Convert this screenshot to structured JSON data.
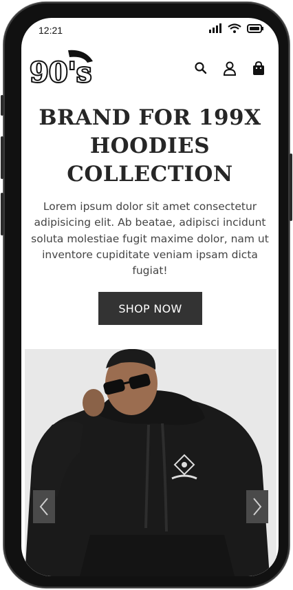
{
  "status_bar": {
    "time": "12:21"
  },
  "header": {
    "logo_text": "90's",
    "icons": [
      "search-icon",
      "user-icon",
      "shopping-bag-icon"
    ]
  },
  "hero": {
    "title_lines": [
      "BRAND FOR 199X",
      "HOODIES",
      "COLLECTION"
    ],
    "description": "Lorem ipsum dolor sit amet consectetur adipisicing elit. Ab beatae, adipisci incidunt soluta molestiae fugit maxime dolor, nam ut inventore cupiditate veniam ipsam dicta fugiat!",
    "cta_label": "SHOP NOW"
  },
  "carousel": {
    "image": "man-in-black-hoodie-with-sunglasses",
    "prev_icon": "chevron-left-icon",
    "next_icon": "chevron-right-icon"
  },
  "colors": {
    "button_bg": "#333333",
    "text": "#262626",
    "arrow_bg": "#4a4a4a"
  }
}
